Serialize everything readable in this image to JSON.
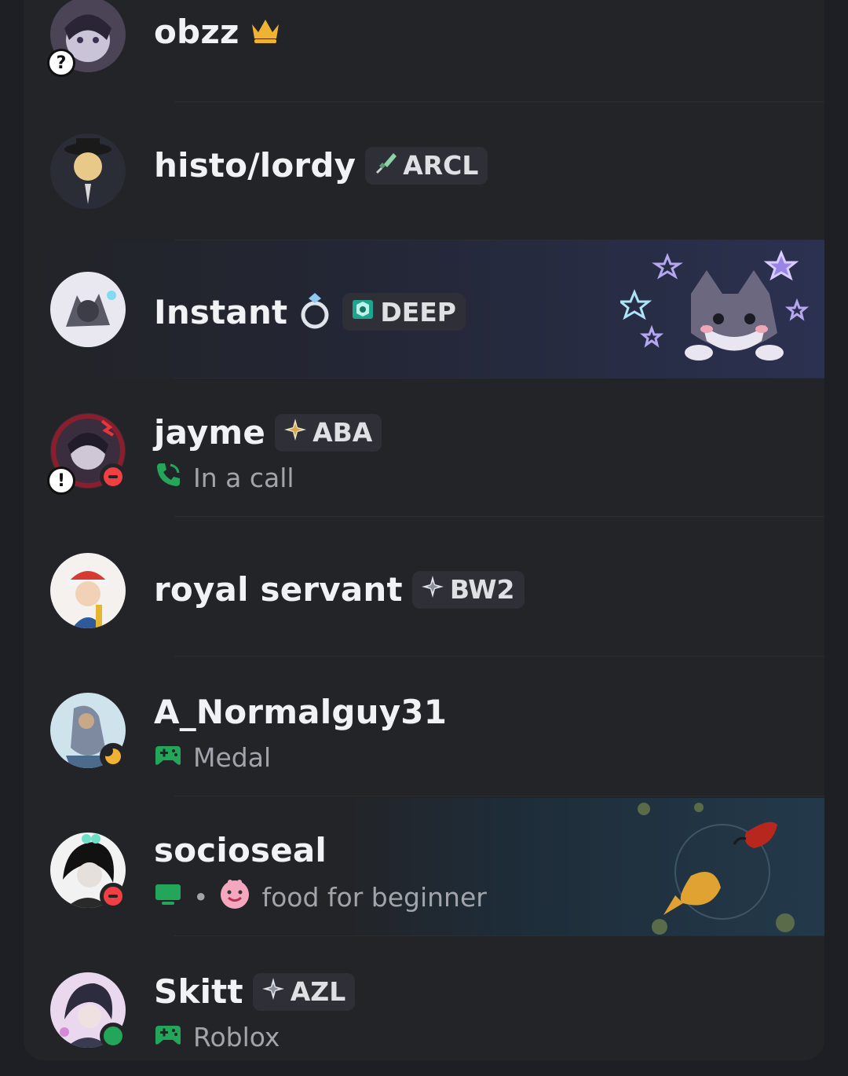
{
  "members": [
    {
      "name": "obzz",
      "badge_icon": "crown-icon"
    },
    {
      "name": "histo/lordy",
      "tag": "ARCL",
      "tag_icon": "sword-icon"
    },
    {
      "name": "Instant",
      "badge_icon": "ring-icon",
      "tag": "DEEP",
      "tag_icon": "gem-icon"
    },
    {
      "name": "jayme",
      "tag": "ABA",
      "tag_icon": "sparkle-icon",
      "activity": "In a call",
      "activity_icon": "phone-icon",
      "status": "dnd"
    },
    {
      "name": "royal servant",
      "tag": "BW2",
      "tag_icon": "sparkle-icon"
    },
    {
      "name": "A_Normalguy31",
      "activity": "Medal",
      "activity_icon": "gamepad-icon",
      "status": "idle"
    },
    {
      "name": "socioseal",
      "activity": "food for beginner",
      "activity_icon": "monitor-icon",
      "status": "dnd"
    },
    {
      "name": "Skitt",
      "tag": "AZL",
      "tag_icon": "sparkle-icon",
      "activity": "Roblox",
      "activity_icon": "gamepad-icon",
      "status": "online"
    }
  ],
  "colors": {
    "background": "#1e1f24",
    "panel": "#232428",
    "name": "#f1f2f4",
    "muted": "#a2a4ab",
    "green": "#23a55a",
    "red": "#f23f43",
    "idle": "#f0b232",
    "crown": "#f0b232"
  }
}
